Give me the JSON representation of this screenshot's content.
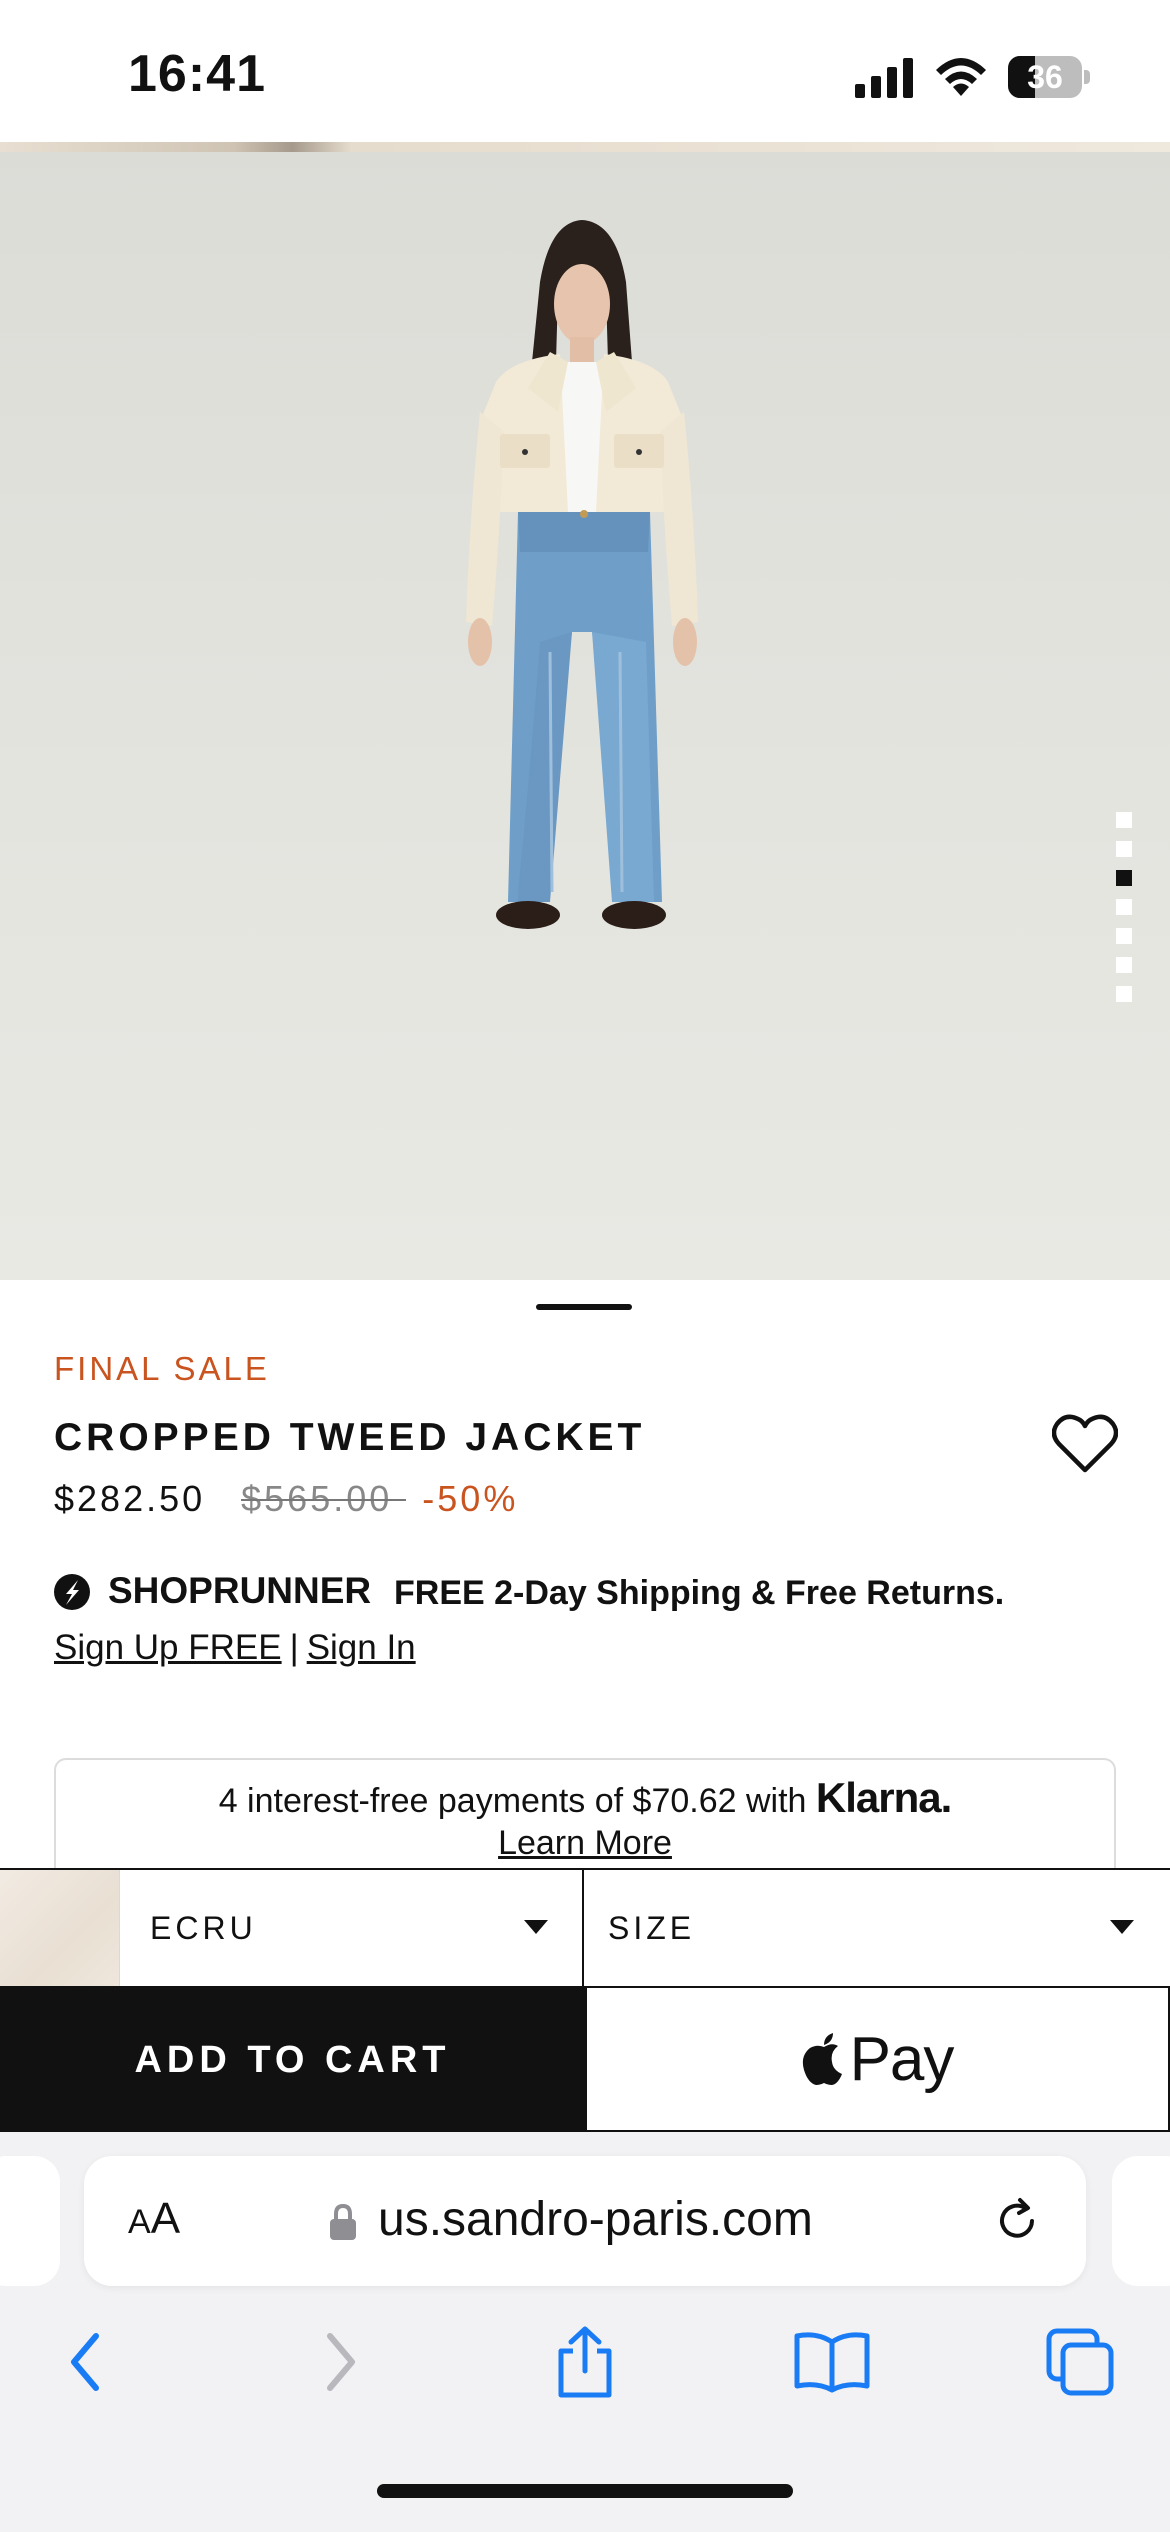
{
  "status_bar": {
    "time": "16:41",
    "battery_percent": 36,
    "battery_label": "36"
  },
  "gallery": {
    "image_count": 7,
    "active_index": 2
  },
  "product": {
    "tag": "FINAL SALE",
    "name": "CROPPED TWEED JACKET",
    "price": "$282.50",
    "original_price": "$565.00",
    "discount": "-50%"
  },
  "shoprunner": {
    "brand": "SHOPRUNNER",
    "offer": "FREE 2-Day Shipping & Free Returns.",
    "sign_up": "Sign Up FREE",
    "separator": "|",
    "sign_in": "Sign In"
  },
  "klarna": {
    "text": "4 interest-free payments of $70.62 with",
    "logo": "Klarna.",
    "learn_more": "Learn More"
  },
  "selectors": {
    "color": "ECRU",
    "size": "SIZE"
  },
  "actions": {
    "add_to_cart": "ADD TO CART",
    "apple_pay": "Pay"
  },
  "browser": {
    "aa_small": "A",
    "aa_large": "A",
    "url": "us.sandro-paris.com"
  },
  "colors": {
    "accent": "#c9541f",
    "safari_blue": "#1a7cf5",
    "button_black": "#111111"
  },
  "icons": [
    "signal-icon",
    "wifi-icon",
    "battery-icon",
    "heart-icon",
    "shoprunner-logo-icon",
    "chevron-down-icon",
    "apple-logo-icon",
    "lock-icon",
    "reload-icon",
    "back-icon",
    "forward-icon",
    "share-icon",
    "bookmarks-icon",
    "tabs-icon"
  ]
}
